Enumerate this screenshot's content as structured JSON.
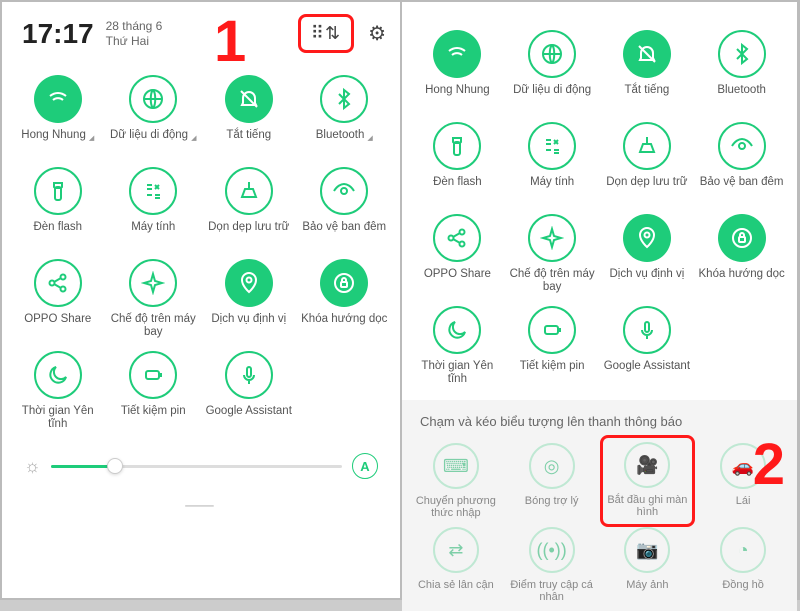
{
  "status": {
    "time": "17:17",
    "date_line1": "28 tháng 6",
    "date_line2": "Thứ Hai",
    "auto": "A"
  },
  "annotations": {
    "one": "1",
    "two": "2"
  },
  "tiles_left": [
    {
      "icon": "wifi",
      "label": "Hong Nhung",
      "active": true,
      "tri": true
    },
    {
      "icon": "globe",
      "label": "Dữ liệu di động",
      "active": false,
      "tri": true
    },
    {
      "icon": "bell-off",
      "label": "Tắt tiếng",
      "active": true,
      "tri": false
    },
    {
      "icon": "bluetooth",
      "label": "Bluetooth",
      "active": false,
      "tri": true
    },
    {
      "icon": "flashlight",
      "label": "Đèn flash",
      "active": false,
      "tri": false
    },
    {
      "icon": "calc",
      "label": "Máy tính",
      "active": false,
      "tri": false
    },
    {
      "icon": "broom",
      "label": "Dọn dẹp lưu trữ",
      "active": false,
      "tri": false
    },
    {
      "icon": "eye",
      "label": "Bảo vệ ban đêm",
      "active": false,
      "tri": false
    },
    {
      "icon": "share",
      "label": "OPPO Share",
      "active": false,
      "tri": false
    },
    {
      "icon": "plane",
      "label": "Chế độ trên máy bay",
      "active": false,
      "tri": false
    },
    {
      "icon": "location",
      "label": "Dịch vụ định vị",
      "active": true,
      "tri": false
    },
    {
      "icon": "lock-rotate",
      "label": "Khóa hướng dọc",
      "active": true,
      "tri": false
    },
    {
      "icon": "moon",
      "label": "Thời gian Yên tĩnh",
      "active": false,
      "tri": false
    },
    {
      "icon": "battery",
      "label": "Tiết kiệm pin",
      "active": false,
      "tri": false
    },
    {
      "icon": "mic",
      "label": "Google Assistant",
      "active": false,
      "tri": false
    }
  ],
  "tiles_right_top": [
    {
      "icon": "wifi",
      "label": "Hong Nhung",
      "active": true
    },
    {
      "icon": "globe",
      "label": "Dữ liệu di động",
      "active": false
    },
    {
      "icon": "bell-off",
      "label": "Tắt tiếng",
      "active": true
    },
    {
      "icon": "bluetooth",
      "label": "Bluetooth",
      "active": false
    },
    {
      "icon": "flashlight",
      "label": "Đèn flash",
      "active": false
    },
    {
      "icon": "calc",
      "label": "Máy tính",
      "active": false
    },
    {
      "icon": "broom",
      "label": "Dọn dẹp lưu trữ",
      "active": false
    },
    {
      "icon": "eye",
      "label": "Bảo vệ ban đêm",
      "active": false
    },
    {
      "icon": "share",
      "label": "OPPO Share",
      "active": false
    },
    {
      "icon": "plane",
      "label": "Chế độ trên máy bay",
      "active": false
    },
    {
      "icon": "location",
      "label": "Dịch vụ định vị",
      "active": true
    },
    {
      "icon": "lock-rotate",
      "label": "Khóa hướng dọc",
      "active": true
    },
    {
      "icon": "moon",
      "label": "Thời gian Yên tĩnh",
      "active": false
    },
    {
      "icon": "battery",
      "label": "Tiết kiệm pin",
      "active": false
    },
    {
      "icon": "mic",
      "label": "Google Assistant",
      "active": false
    }
  ],
  "drag": {
    "title": "Chạm và kéo biểu tượng lên thanh thông báo",
    "items": [
      {
        "icon": "keyboard",
        "label": "Chuyển phương thức nhập",
        "hi": false
      },
      {
        "icon": "circle-dot",
        "label": "Bóng trợ lý",
        "hi": false
      },
      {
        "icon": "video",
        "label": "Bắt đầu ghi màn hình",
        "hi": true
      },
      {
        "icon": "car",
        "label": "Lái",
        "hi": false
      },
      {
        "icon": "dna",
        "label": "Chia sẻ lân cận",
        "hi": false
      },
      {
        "icon": "hotspot",
        "label": "Điểm truy cập cá nhân",
        "hi": false
      },
      {
        "icon": "camera",
        "label": "Máy ảnh",
        "hi": false
      },
      {
        "icon": "clock",
        "label": "Đồng hồ",
        "hi": false
      }
    ]
  }
}
